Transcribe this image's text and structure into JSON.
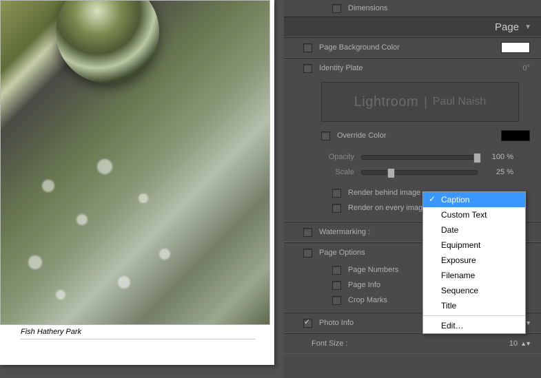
{
  "left": {
    "caption": "Fish Hathery Park"
  },
  "top_row": {
    "dimensions_label": "Dimensions"
  },
  "page_header": "Page",
  "bg": {
    "label": "Page Background Color",
    "swatch": "#ffffff"
  },
  "identity": {
    "label": "Identity Plate",
    "angle": "0°",
    "plate_app": "Lightroom",
    "plate_name": "Paul Naish",
    "override_label": "Override Color",
    "override_swatch": "#000000",
    "opacity_label": "Opacity",
    "opacity_value": "100 %",
    "scale_label": "Scale",
    "scale_value": "25 %",
    "render_behind": "Render behind image",
    "render_every": "Render on every image"
  },
  "watermark": {
    "label": "Watermarking :"
  },
  "page_options": {
    "label": "Page Options",
    "numbers": "Page Numbers",
    "info": "Page Info",
    "crop": "Crop Marks"
  },
  "photo_info": {
    "label": "Photo Info",
    "value": "Caption"
  },
  "font": {
    "label": "Font Size :",
    "value": "10"
  },
  "menu": {
    "items": [
      "Caption",
      "Custom Text",
      "Date",
      "Equipment",
      "Exposure",
      "Filename",
      "Sequence",
      "Title"
    ],
    "edit": "Edit…"
  }
}
